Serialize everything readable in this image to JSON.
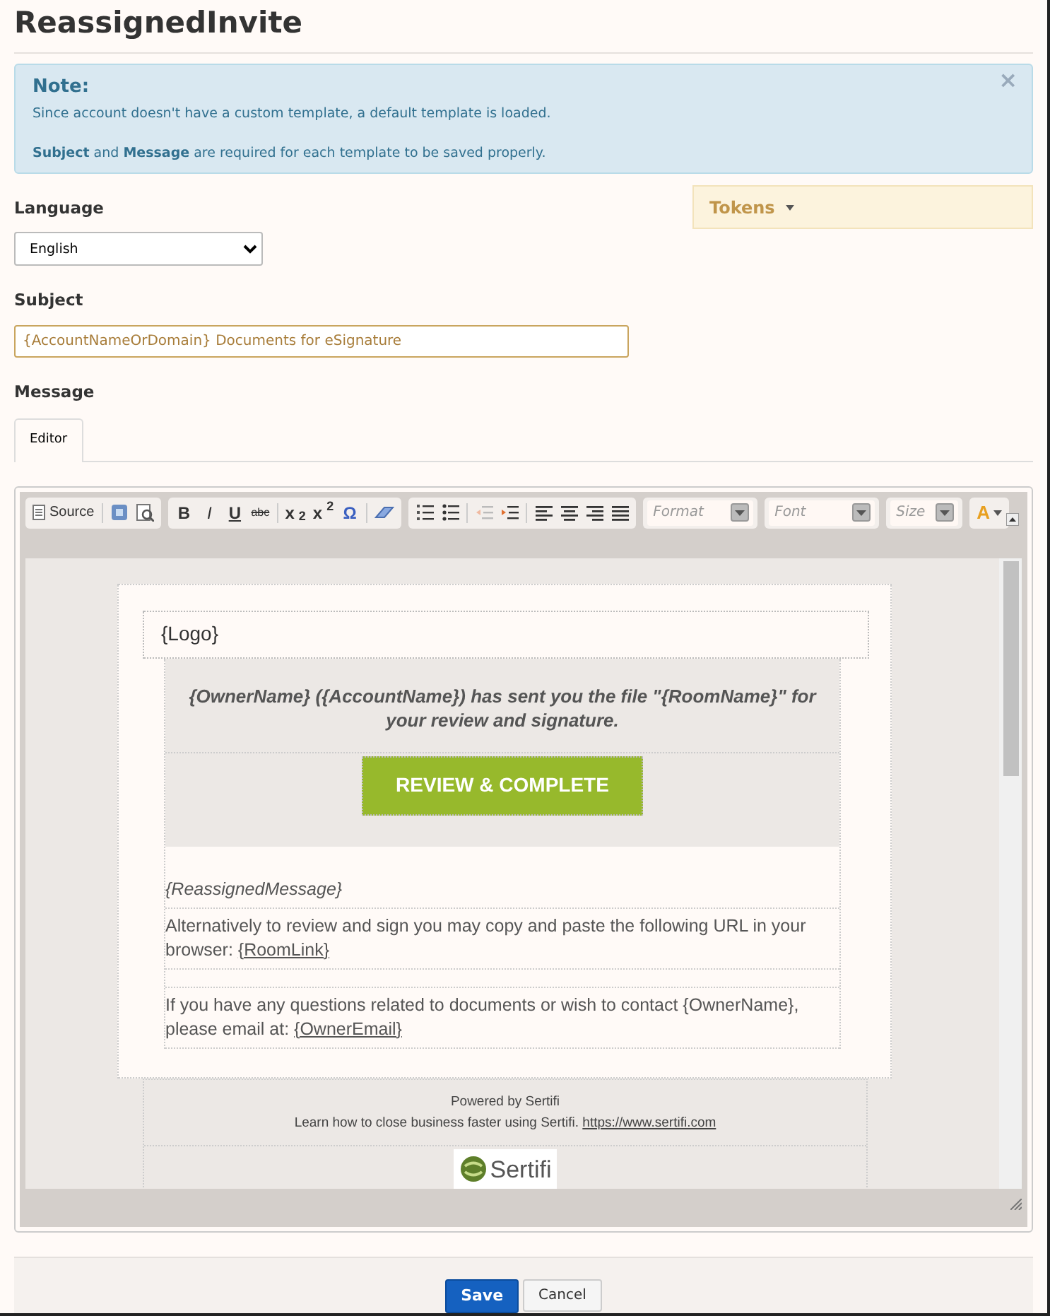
{
  "title": "ReassignedInvite",
  "note": {
    "heading": "Note:",
    "close": "×",
    "lines": [
      "Since account doesn't have a custom template, a default template is loaded.",
      "**Subject** and **Message** are required for each template to be saved properly."
    ]
  },
  "language": {
    "label": "Language",
    "value": "English"
  },
  "tokens": {
    "label": "Tokens"
  },
  "subject": {
    "label": "Subject",
    "value": "{AccountNameOrDomain} Documents for eSignature"
  },
  "message": {
    "label": "Message",
    "tabs": [
      {
        "label": "Editor",
        "selected": true
      }
    ]
  },
  "toolbar": [
    {
      "items": [
        {
          "kind": "source",
          "label": "Source"
        },
        {
          "kind": "separator"
        },
        {
          "kind": "maximize"
        },
        {
          "kind": "preview"
        }
      ]
    },
    {
      "items": [
        {
          "kind": "bold",
          "label": "B"
        },
        {
          "kind": "italic",
          "label": "I"
        },
        {
          "kind": "underline",
          "label": "U"
        },
        {
          "kind": "strike",
          "label": "abc"
        },
        {
          "kind": "separator"
        },
        {
          "kind": "glyph",
          "label": "x$_{2}$"
        },
        {
          "kind": "glyph",
          "label": "x$^{2}$"
        },
        {
          "kind": "omega",
          "label": "Ω"
        },
        {
          "kind": "separator"
        },
        {
          "kind": "eraser"
        }
      ]
    },
    {
      "items": [
        {
          "kind": "numbered"
        },
        {
          "kind": "bulleted"
        },
        {
          "kind": "separator"
        },
        {
          "kind": "outdent"
        },
        {
          "kind": "indent"
        },
        {
          "kind": "separator"
        },
        {
          "kind": "align-left"
        },
        {
          "kind": "align-center"
        },
        {
          "kind": "align-right"
        },
        {
          "kind": "justify"
        }
      ]
    },
    {
      "items": [
        {
          "kind": "combo",
          "placeholder": "Format"
        }
      ]
    },
    {
      "items": [
        {
          "kind": "combo",
          "placeholder": "Font"
        }
      ]
    },
    {
      "items": [
        {
          "kind": "combo",
          "placeholder": "Size"
        }
      ]
    },
    {
      "items": [
        {
          "kind": "textcolor",
          "label": "A"
        }
      ]
    }
  ],
  "email": {
    "logo": "{Logo}",
    "headline": "{OwnerName} ({AccountName}) has sent you the file \"{RoomName}\" for your review and signature.",
    "cta": "REVIEW & COMPLETE",
    "reassigned": "{ReassignedMessage}",
    "paragraphs": [
      {
        "text": "Alternatively to review and sign you may copy and paste the following URL in your browser: ",
        "link": "{RoomLink}"
      },
      {
        "text": "If you have any questions related to documents or wish to contact {OwnerName}, please email at: ",
        "link": "{OwnerEmail}"
      }
    ],
    "footer": {
      "powered": "Powered by Sertifi",
      "learn": "Learn how to close business faster using Sertifi. ",
      "link": "https://www.sertifi.com",
      "brand": "Sertifi"
    }
  },
  "buttons": [
    {
      "kind": "primary",
      "label": "Save"
    },
    {
      "kind": "secondary",
      "label": "Cancel"
    }
  ]
}
